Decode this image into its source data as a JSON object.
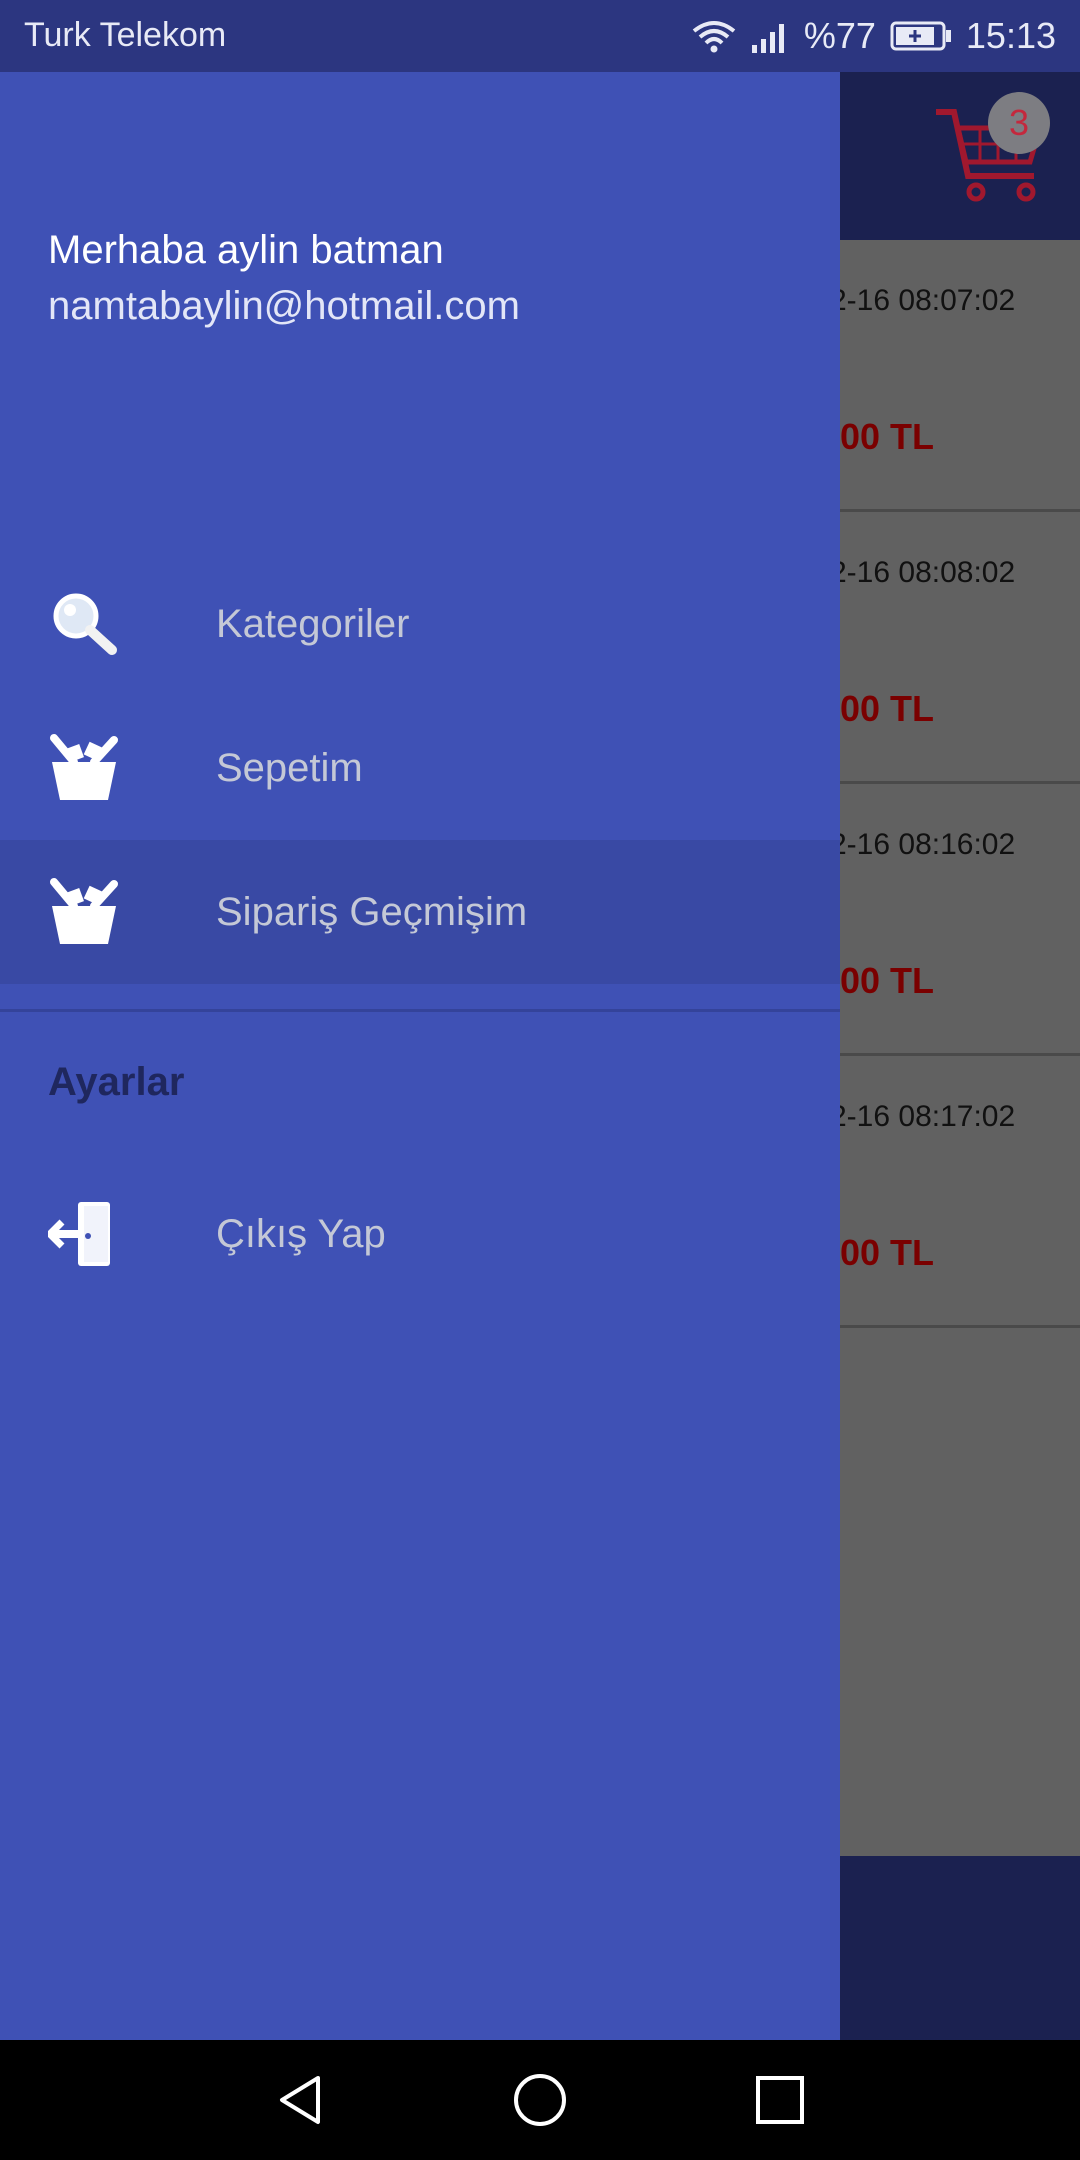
{
  "status_bar": {
    "carrier": "Turk Telekom",
    "battery": "%77",
    "time": "15:13"
  },
  "toolbar": {
    "cart_count": "3",
    "cart_icon": "shopping-cart-icon"
  },
  "orders": [
    {
      "date": "2-16 08:07:02",
      "price": ".00 TL"
    },
    {
      "date": "2-16 08:08:02",
      "price": ".00 TL"
    },
    {
      "date": "2-16 08:16:02",
      "price": ".00 TL"
    },
    {
      "date": "2-16 08:17:02",
      "price": ".00 TL"
    }
  ],
  "drawer": {
    "greeting": "Merhaba aylin batman",
    "email": "namtabaylin@hotmail.com",
    "items": [
      {
        "label": "Kategoriler",
        "icon": "magnifier-icon"
      },
      {
        "label": "Sepetim",
        "icon": "basket-icon"
      },
      {
        "label": "Sipariş Geçmişim",
        "icon": "basket-icon",
        "active": true
      }
    ],
    "section_title": "Ayarlar",
    "logout": {
      "label": "Çıkış Yap",
      "icon": "logout-door-icon"
    }
  },
  "colors": {
    "drawer_bg": "#3f51b5",
    "active_item_bg": "#3949a4",
    "price_red": "#7a0000",
    "cart_red": "#c4283d"
  }
}
